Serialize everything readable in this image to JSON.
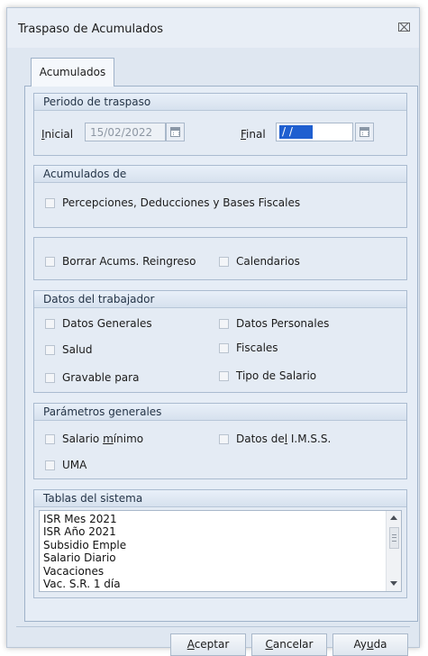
{
  "window": {
    "title": "Traspaso de Acumulados",
    "close_icon": "close-icon"
  },
  "tabs": [
    {
      "label": "Acumulados",
      "selected": true
    }
  ],
  "periodo": {
    "title": "Periodo de traspaso",
    "inicial": {
      "label_mnemonic": "I",
      "label_rest": "nicial",
      "value": "15/02/2022"
    },
    "final": {
      "label_mnemonic": "F",
      "label_rest": "inal",
      "value": "/ /"
    }
  },
  "acumulados_de": {
    "title": "Acumulados de",
    "options": [
      {
        "label": "Percepciones, Deducciones y Bases Fiscales",
        "checked": false
      }
    ]
  },
  "misc": {
    "options": [
      {
        "label": "Borrar Acums. Reingreso",
        "checked": false
      },
      {
        "label": "Calendarios",
        "checked": false
      }
    ]
  },
  "datos_trabajador": {
    "title": "Datos del trabajador",
    "options": [
      {
        "label": "Datos Generales",
        "checked": false
      },
      {
        "label": "Datos Personales",
        "checked": false
      },
      {
        "label": "Salud",
        "checked": false
      },
      {
        "label": "Fiscales",
        "checked": false
      },
      {
        "label": "Gravable para",
        "checked": false
      },
      {
        "label": "Tipo de Salario",
        "checked": false
      }
    ]
  },
  "parametros": {
    "title": "Parámetros generales",
    "salario": {
      "pre": "Salario ",
      "mnemonic": "m",
      "post": "ínimo",
      "checked": false
    },
    "imss": {
      "pre": "Datos de",
      "mnemonic": "l",
      "post": " I.M.S.S.",
      "checked": false
    },
    "uma": {
      "label": "UMA",
      "checked": false
    }
  },
  "tablas": {
    "title": "Tablas del sistema",
    "items": [
      " ISR Mes 2021",
      " ISR Año 2021",
      "  Subsidio Emple",
      "Salario Diario",
      "Vacaciones",
      "Vac. S.R. 1 día"
    ]
  },
  "buttons": {
    "aceptar": {
      "mnemonic": "A",
      "rest": "ceptar"
    },
    "cancelar": {
      "mnemonic": "C",
      "rest": "ancelar"
    },
    "ayuda": {
      "pre": "Ay",
      "mnemonic": "u",
      "post": "da"
    }
  },
  "colors": {
    "accent": "#1f5fd0",
    "frame": "#dfe7f1"
  }
}
